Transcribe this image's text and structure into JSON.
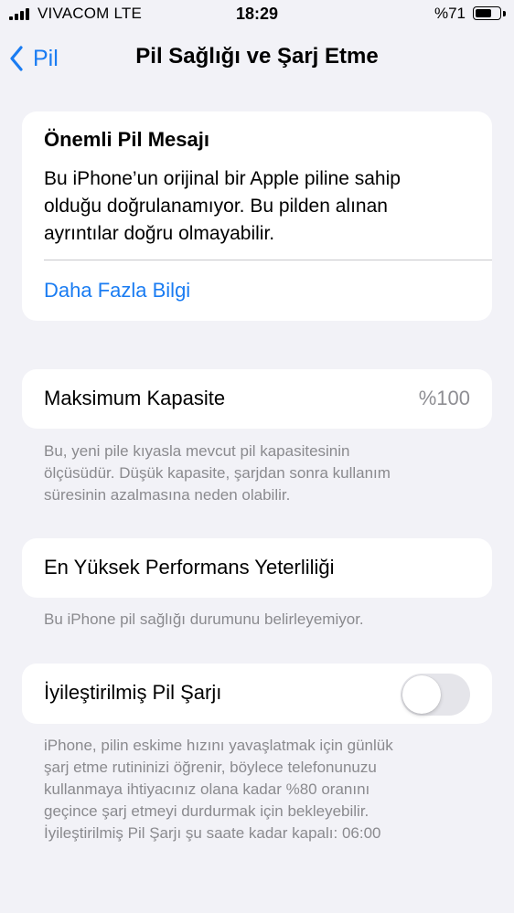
{
  "status_bar": {
    "carrier": "VIVACOM  LTE",
    "time": "18:29",
    "battery_text": "%71",
    "battery_level": 0.71
  },
  "nav": {
    "back_label": "Pil",
    "title": "Pil Sağlığı ve Şarj Etme"
  },
  "important_message": {
    "title": "Önemli Pil Mesajı",
    "lines": [
      "Bu iPhone’un orijinal bir Apple piline sahip",
      "olduğu doğrulanamıyor. Bu pilden alınan",
      "ayrıntılar doğru olmayabilir."
    ],
    "link": "Daha Fazla Bilgi"
  },
  "max_capacity": {
    "label": "Maksimum Kapasite",
    "value": "%100",
    "footnote_lines": [
      "Bu, yeni pile kıyasla mevcut pil kapasitesinin",
      "ölçüsüdür. Düşük kapasite, şarjdan sonra kullanım",
      "süresinin azalmasına neden olabilir."
    ]
  },
  "peak_performance": {
    "label": "En Yüksek Performans Yeterliliği",
    "footnote": "Bu iPhone pil sağlığı durumunu belirleyemiyor."
  },
  "optimized_charging": {
    "label": "İyileştirilmiş Pil Şarjı",
    "enabled": false,
    "footnote_lines": [
      "iPhone, pilin eskime hızını yavaşlatmak için günlük",
      "şarj etme rutininizi öğrenir, böylece telefonunuzu",
      "kullanmaya ihtiyacınız olana kadar %80 oranını",
      "geçince şarj etmeyi durdurmak için bekleyebilir.",
      "İyileştirilmiş Pil Şarjı şu saate kadar kapalı: 06:00"
    ]
  },
  "colors": {
    "accent": "#1a7cf2",
    "background": "#f2f2f7",
    "secondary_text": "#8a8a8e",
    "toggle_off": "#e5e5ea"
  },
  "icons": {
    "signal": "cellular-signal-icon",
    "battery": "battery-icon",
    "back": "chevron-left-icon"
  }
}
